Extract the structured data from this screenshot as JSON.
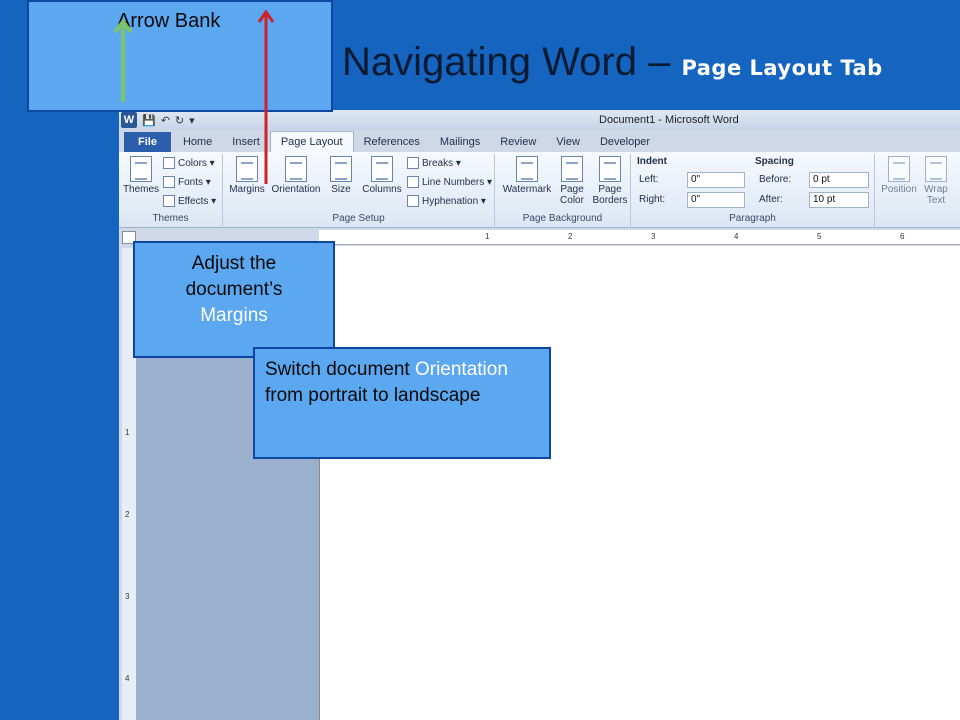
{
  "slide": {
    "title_main": "Navigating Word – ",
    "title_sub": "Page Layout Tab",
    "arrow_bank_label": "Arrow Bank"
  },
  "word": {
    "window_title": "Document1 - Microsoft Word",
    "tabs": [
      {
        "label": "File"
      },
      {
        "label": "Home"
      },
      {
        "label": "Insert"
      },
      {
        "label": "Page Layout"
      },
      {
        "label": "References"
      },
      {
        "label": "Mailings"
      },
      {
        "label": "Review"
      },
      {
        "label": "View"
      },
      {
        "label": "Developer"
      }
    ],
    "themes_group": {
      "label": "Themes",
      "themes_btn": "Themes",
      "colors": "Colors ▾",
      "fonts": "Fonts ▾",
      "effects": "Effects ▾"
    },
    "page_setup": {
      "label": "Page Setup",
      "margins": "Margins",
      "orientation": "Orientation",
      "size": "Size",
      "columns": "Columns",
      "breaks": "Breaks ▾",
      "line_numbers": "Line Numbers ▾",
      "hyphenation": "Hyphenation ▾"
    },
    "page_background": {
      "label": "Page Background",
      "watermark": "Watermark",
      "page_color": "Page Color",
      "page_borders": "Page Borders"
    },
    "paragraph": {
      "label": "Paragraph",
      "indent": "Indent",
      "left_label": "Left:",
      "left_value": "0\"",
      "right_label": "Right:",
      "right_value": "0\"",
      "spacing": "Spacing",
      "before_label": "Before:",
      "before_value": "0 pt",
      "after_label": "After:",
      "after_value": "10 pt"
    },
    "arrange": {
      "position": "Position",
      "wrap_text": "Wrap Text"
    },
    "ruler_numbers": [
      "1",
      "2",
      "3",
      "4",
      "5",
      "6"
    ],
    "vruler_numbers": [
      "1",
      "2",
      "3",
      "4"
    ]
  },
  "callouts": {
    "margins_line1": "Adjust the",
    "margins_line2": "document’s",
    "margins_line3": "Margins",
    "orient_part1": "Switch document ",
    "orient_highlight": "Orientation",
    "orient_part2": " from portrait to landscape"
  },
  "colors": {
    "slide_bg": "#1565c0",
    "callout_bg": "#5ba7f0",
    "green_arrow": "#7cc36a",
    "red_arrow": "#d0202a"
  }
}
